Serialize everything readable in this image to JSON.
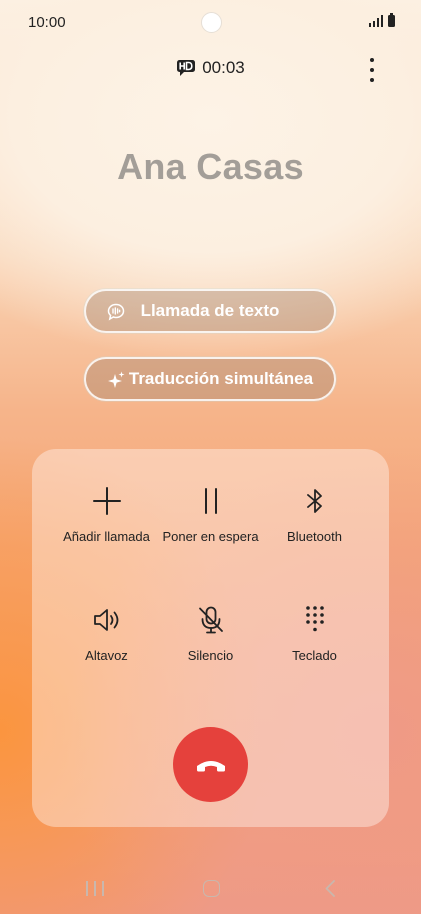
{
  "status_bar": {
    "time": "10:00",
    "icons": [
      "signal-icon",
      "battery-icon"
    ]
  },
  "call": {
    "hd_icon": "hd-voice-icon",
    "timer": "00:03",
    "caller_name": "Ana Casas"
  },
  "actions": {
    "text_call": {
      "label": "Llamada de texto",
      "icon": "text-call-icon"
    },
    "translation": {
      "label": "Traducción simultánea",
      "icon": "sparkle-icon"
    }
  },
  "controls": [
    {
      "label": "Añadir llamada",
      "icon": "plus-icon"
    },
    {
      "label": "Poner en espera",
      "icon": "pause-icon"
    },
    {
      "label": "Bluetooth",
      "icon": "bluetooth-icon"
    },
    {
      "label": "Altavoz",
      "icon": "speaker-icon"
    },
    {
      "label": "Silencio",
      "icon": "mic-off-icon"
    },
    {
      "label": "Teclado",
      "icon": "keypad-icon"
    }
  ],
  "end_call": {
    "icon": "end-call-icon",
    "color": "#e5413c"
  },
  "nav": [
    "recent-apps-icon",
    "home-icon",
    "back-icon"
  ]
}
